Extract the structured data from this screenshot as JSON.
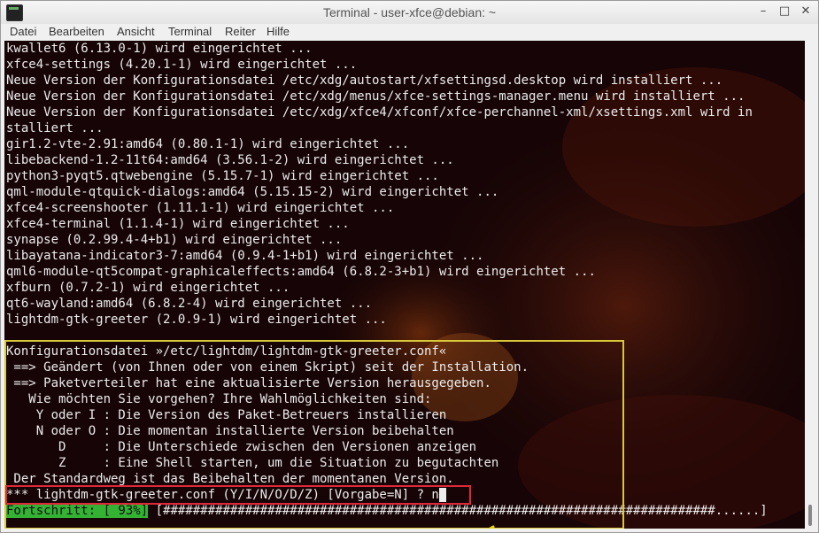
{
  "window": {
    "title": "Terminal - user-xfce@debian: ~",
    "controls": {
      "minimize": "–",
      "maximize": "□",
      "close": "✕"
    }
  },
  "menu": [
    "Datei",
    "Bearbeiten",
    "Ansicht",
    "Terminal",
    "Reiter",
    "Hilfe"
  ],
  "terminal": {
    "output_lines": [
      "kwallet6 (6.13.0-1) wird eingerichtet ...",
      "xfce4-settings (4.20.1-1) wird eingerichtet ...",
      "Neue Version der Konfigurationsdatei /etc/xdg/autostart/xfsettingsd.desktop wird installiert ...",
      "Neue Version der Konfigurationsdatei /etc/xdg/menus/xfce-settings-manager.menu wird installiert ...",
      "Neue Version der Konfigurationsdatei /etc/xdg/xfce4/xfconf/xfce-perchannel-xml/xsettings.xml wird in",
      "stalliert ...",
      "gir1.2-vte-2.91:amd64 (0.80.1-1) wird eingerichtet ...",
      "libebackend-1.2-11t64:amd64 (3.56.1-2) wird eingerichtet ...",
      "python3-pyqt5.qtwebengine (5.15.7-1) wird eingerichtet ...",
      "qml-module-qtquick-dialogs:amd64 (5.15.15-2) wird eingerichtet ...",
      "xfce4-screenshooter (1.11.1-1) wird eingerichtet ...",
      "xfce4-terminal (1.1.4-1) wird eingerichtet ...",
      "synapse (0.2.99.4-4+b1) wird eingerichtet ...",
      "libayatana-indicator3-7:amd64 (0.9.4-1+b1) wird eingerichtet ...",
      "qml6-module-qt5compat-graphicaleffects:amd64 (6.8.2-3+b1) wird eingerichtet ...",
      "xfburn (0.7.2-1) wird eingerichtet ...",
      "qt6-wayland:amd64 (6.8.2-4) wird eingerichtet ...",
      "lightdm-gtk-greeter (2.0.9-1) wird eingerichtet ...",
      "",
      "Konfigurationsdatei »/etc/lightdm/lightdm-gtk-greeter.conf«",
      " ==> Geändert (von Ihnen oder von einem Skript) seit der Installation.",
      " ==> Paketverteiler hat eine aktualisierte Version herausgegeben.",
      "   Wie möchten Sie vorgehen? Ihre Wahlmöglichkeiten sind:",
      "    Y oder I : Die Version des Paket-Betreuers installieren",
      "    N oder O : Die momentan installierte Version beibehalten",
      "       D     : Die Unterschiede zwischen den Versionen anzeigen",
      "       Z     : Eine Shell starten, um die Situation zu begutachten",
      " Der Standardweg ist das Beibehalten der momentanen Version."
    ],
    "prompt": "*** lightdm-gtk-greeter.conf (Y/I/N/O/D/Z) [Vorgabe=N] ? n",
    "progress_label": "Fortschritt: [ 93%]",
    "progress_bar": " [##########################################################################......]",
    "progress_percent": 93
  },
  "colors": {
    "terminal_bg": "#160406",
    "highlight_yellow": "#d8c83a",
    "highlight_red": "#e0283a",
    "arrow": "#f0d000",
    "progress_green": "#33b233"
  }
}
